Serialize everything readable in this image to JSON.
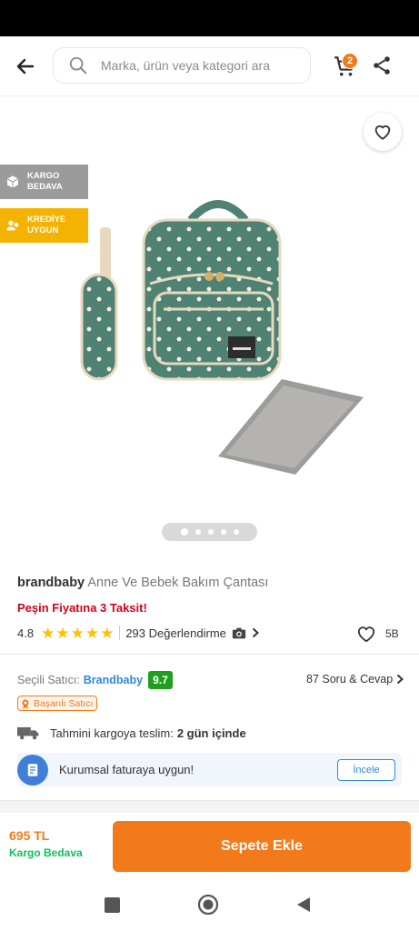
{
  "search": {
    "placeholder": "Marka, ürün veya kategori ara"
  },
  "cart": {
    "count": "2"
  },
  "badges": {
    "kargo": [
      "KARGO",
      "BEDAVA"
    ],
    "kredi": [
      "KREDİYE",
      "UYGUN"
    ]
  },
  "product": {
    "brand": "brandbaby",
    "name": "Anne Ve Bebek Bakım Çantası",
    "promo": "Peşin Fiyatına 3 Taksit!",
    "rating": "4.8",
    "reviews": "293 Değerlendirme",
    "likes": "5B",
    "image_slide_count": 5,
    "image_active_index": 0
  },
  "seller": {
    "label": "Seçili Satıcı:",
    "name": "Brandbaby",
    "score": "9.7",
    "qa": "87 Soru & Cevap",
    "badge": "Başarılı Satıcı"
  },
  "shipping": {
    "label": "Tahmini kargoya teslim:",
    "value": "2 gün içinde"
  },
  "invoice": {
    "text": "Kurumsal faturaya uygun!",
    "button": "İncele"
  },
  "buy": {
    "price": "695 TL",
    "shipping": "Kargo Bedava",
    "button": "Sepete Ekle"
  },
  "colors": {
    "accent": "#f27a1a",
    "promo": "#d0021b",
    "score": "#1ea01e",
    "free_ship": "#0bc15c",
    "link": "#2e86de"
  }
}
